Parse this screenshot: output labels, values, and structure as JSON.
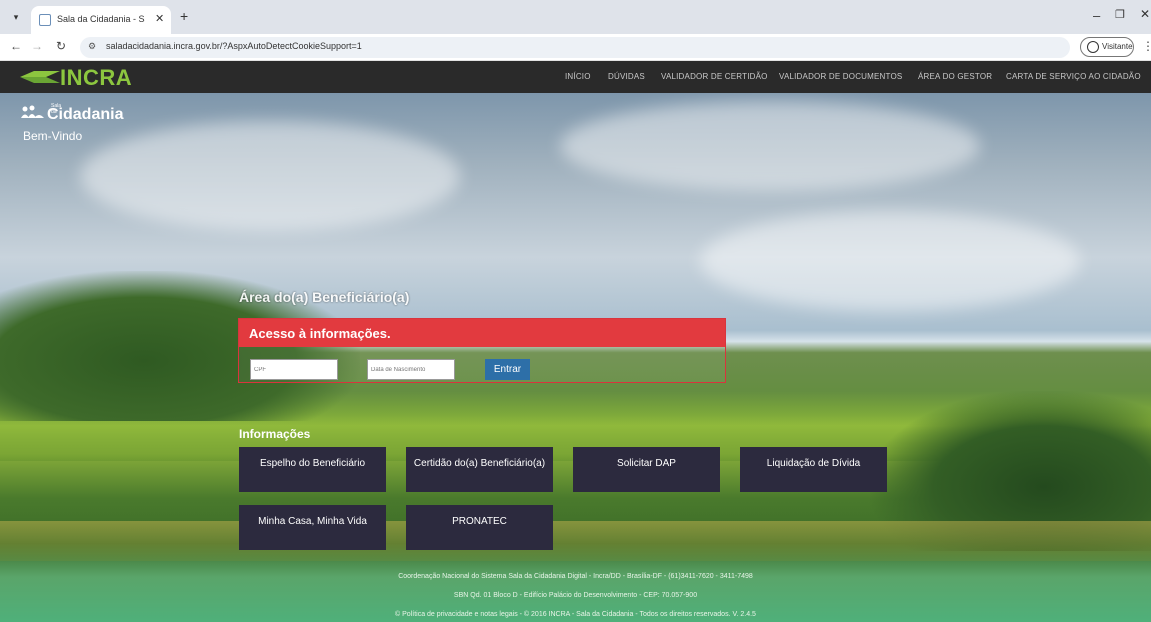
{
  "browser": {
    "tab_title": "Sala da Cidadania - Sala da Cid",
    "url": "saladacidadania.incra.gov.br/?AspxAutoDetectCookieSupport=1",
    "profile_label": "Visitante"
  },
  "header": {
    "logo_text": "INCRA",
    "nav": [
      "INÍCIO",
      "DÚVIDAS",
      "VALIDADOR DE CERTIDÃO",
      "VALIDADOR DE DOCUMENTOS",
      "ÁREA DO GESTOR",
      "CARTA DE SERVIÇO AO CIDADÃO"
    ]
  },
  "brand": {
    "small": "Sala da",
    "name": "Cidadania",
    "welcome": "Bem-Vindo"
  },
  "access": {
    "area_title": "Área do(a) Beneficiário(a)",
    "header": "Acesso à informações.",
    "cpf_placeholder": "CPF",
    "dob_placeholder": "Data de Nascimento",
    "submit_label": "Entrar"
  },
  "info": {
    "title": "Informações",
    "cards": [
      "Espelho do Beneficiário",
      "Certidão do(a) Beneficiário(a)",
      "Solicitar DAP",
      "Liquidação de Dívida",
      "Minha Casa, Minha Vida",
      "PRONATEC"
    ]
  },
  "footer": {
    "line1": "Coordenação Nacional do Sistema Sala da Cidadania Digital - Incra/DD - Brasília-DF - (61)3411-7620 - 3411-7498",
    "line2": "SBN Qd. 01 Bloco D - Edifício Palácio do Desenvolvimento - CEP: 70.057-900",
    "line3": "© Política de privacidade e notas legais - © 2016 INCRA - Sala da Cidadania - Todos os direitos reservados. V. 2.4.5"
  },
  "colors": {
    "accent_red": "#e23a3f",
    "button_blue": "#2d6fa8",
    "card_dark": "#2c2a3e",
    "logo_green": "#8cc63f"
  }
}
